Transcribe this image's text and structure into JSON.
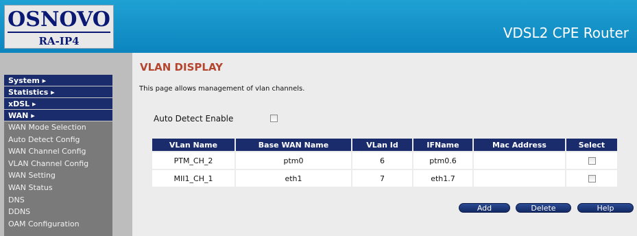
{
  "header": {
    "logo_brand": "OSNOVO",
    "logo_model": "RA-IP4",
    "product_title": "VDSL2 CPE Router"
  },
  "sidebar": {
    "sections": [
      {
        "label": "System ▸"
      },
      {
        "label": "Statistics ▸"
      },
      {
        "label": "xDSL ▸"
      },
      {
        "label": "WAN ▸"
      }
    ],
    "items": [
      {
        "label": "WAN Mode Selection"
      },
      {
        "label": "Auto Detect Config"
      },
      {
        "label": "WAN Channel Config"
      },
      {
        "label": "VLAN Channel Config"
      },
      {
        "label": "WAN Setting"
      },
      {
        "label": "WAN Status"
      },
      {
        "label": "DNS"
      },
      {
        "label": "DDNS"
      },
      {
        "label": "OAM Configuration"
      }
    ]
  },
  "main": {
    "title": "VLAN DISPLAY",
    "description": "This page allows management of vlan channels.",
    "auto_detect_label": "Auto Detect Enable",
    "auto_detect_checked": false,
    "table": {
      "headers": [
        "VLan Name",
        "Base WAN Name",
        "VLan Id",
        "IFName",
        "Mac Address",
        "Select"
      ],
      "rows": [
        {
          "vlan_name": "PTM_CH_2",
          "base_wan": "ptm0",
          "vlan_id": "6",
          "ifname": "ptm0.6",
          "mac": "",
          "selected": false
        },
        {
          "vlan_name": "MII1_CH_1",
          "base_wan": "eth1",
          "vlan_id": "7",
          "ifname": "eth1.7",
          "mac": "",
          "selected": false
        }
      ]
    },
    "buttons": {
      "add": "Add",
      "delete": "Delete",
      "help": "Help"
    }
  },
  "colors": {
    "header_blue": "#0c85bf",
    "nav_dark_blue": "#1a2c6c",
    "title_red": "#b4462f"
  }
}
